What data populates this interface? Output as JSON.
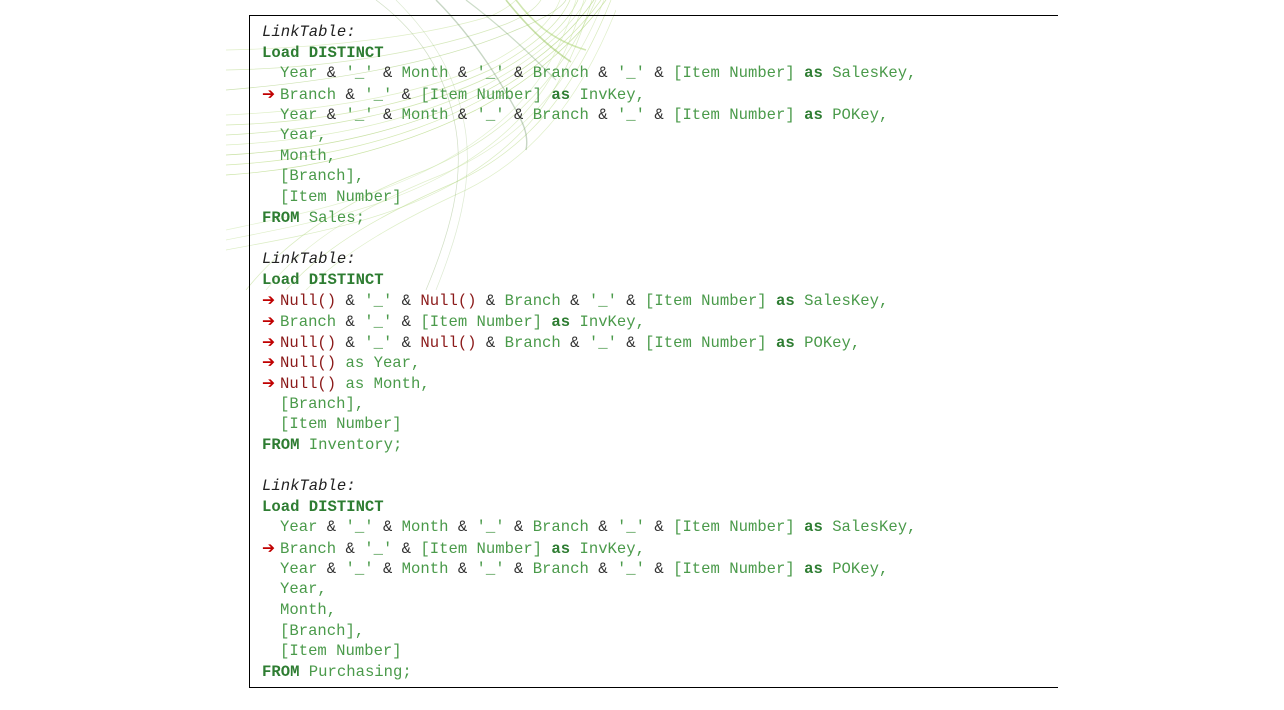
{
  "colors": {
    "keyword": "#2e7d32",
    "identifier": "#4a9a4a",
    "operator": "#333333",
    "null_function": "#8b1a1a",
    "arrow_marker": "#c00000",
    "label": "#222222",
    "swirl": "#8cc63f"
  },
  "icons": {
    "change_marker": "red-right-arrow-icon",
    "background": "green-swirl-decoration"
  },
  "blocks": [
    {
      "lines": [
        {
          "arrow": false,
          "indent": false,
          "tokens": [
            {
              "t": "LinkTable:",
              "c": "label"
            }
          ]
        },
        {
          "arrow": false,
          "indent": false,
          "tokens": [
            {
              "t": "Load DISTINCT",
              "c": "kw"
            }
          ]
        },
        {
          "arrow": false,
          "indent": true,
          "tokens": [
            {
              "t": "Year ",
              "c": "txt"
            },
            {
              "t": "& ",
              "c": "op"
            },
            {
              "t": "'_' ",
              "c": "txt"
            },
            {
              "t": "& ",
              "c": "op"
            },
            {
              "t": "Month ",
              "c": "txt"
            },
            {
              "t": "& ",
              "c": "op"
            },
            {
              "t": "'_' ",
              "c": "txt"
            },
            {
              "t": "& ",
              "c": "op"
            },
            {
              "t": "Branch ",
              "c": "txt"
            },
            {
              "t": "& ",
              "c": "op"
            },
            {
              "t": "'_' ",
              "c": "txt"
            },
            {
              "t": "& ",
              "c": "op"
            },
            {
              "t": "[Item Number] ",
              "c": "txt"
            },
            {
              "t": "as ",
              "c": "kw"
            },
            {
              "t": "SalesKey,",
              "c": "txt"
            }
          ]
        },
        {
          "arrow": true,
          "indent": false,
          "tokens": [
            {
              "t": "Branch ",
              "c": "txt"
            },
            {
              "t": "& ",
              "c": "op"
            },
            {
              "t": "'_' ",
              "c": "txt"
            },
            {
              "t": "& ",
              "c": "op"
            },
            {
              "t": "[Item Number] ",
              "c": "txt"
            },
            {
              "t": "as ",
              "c": "kw"
            },
            {
              "t": "InvKey,",
              "c": "txt"
            }
          ]
        },
        {
          "arrow": false,
          "indent": true,
          "tokens": [
            {
              "t": "Year ",
              "c": "txt"
            },
            {
              "t": "& ",
              "c": "op"
            },
            {
              "t": "'_' ",
              "c": "txt"
            },
            {
              "t": "& ",
              "c": "op"
            },
            {
              "t": "Month ",
              "c": "txt"
            },
            {
              "t": "& ",
              "c": "op"
            },
            {
              "t": "'_' ",
              "c": "txt"
            },
            {
              "t": "& ",
              "c": "op"
            },
            {
              "t": "Branch ",
              "c": "txt"
            },
            {
              "t": "& ",
              "c": "op"
            },
            {
              "t": "'_' ",
              "c": "txt"
            },
            {
              "t": "& ",
              "c": "op"
            },
            {
              "t": "[Item Number] ",
              "c": "txt"
            },
            {
              "t": "as ",
              "c": "kw"
            },
            {
              "t": "POKey,",
              "c": "txt"
            }
          ]
        },
        {
          "arrow": false,
          "indent": true,
          "tokens": [
            {
              "t": "Year,",
              "c": "txt"
            }
          ]
        },
        {
          "arrow": false,
          "indent": true,
          "tokens": [
            {
              "t": "Month,",
              "c": "txt"
            }
          ]
        },
        {
          "arrow": false,
          "indent": true,
          "tokens": [
            {
              "t": "[Branch],",
              "c": "txt"
            }
          ]
        },
        {
          "arrow": false,
          "indent": true,
          "tokens": [
            {
              "t": "[Item Number]",
              "c": "txt"
            }
          ]
        },
        {
          "arrow": false,
          "indent": false,
          "tokens": [
            {
              "t": "FROM ",
              "c": "kw"
            },
            {
              "t": "Sales;",
              "c": "txt"
            }
          ]
        }
      ]
    },
    {
      "lines": [
        {
          "arrow": false,
          "indent": false,
          "tokens": [
            {
              "t": "LinkTable:",
              "c": "label"
            }
          ]
        },
        {
          "arrow": false,
          "indent": false,
          "tokens": [
            {
              "t": "Load DISTINCT",
              "c": "kw"
            }
          ]
        },
        {
          "arrow": true,
          "indent": false,
          "tokens": [
            {
              "t": "Null() ",
              "c": "fn"
            },
            {
              "t": "& ",
              "c": "op"
            },
            {
              "t": "'_' ",
              "c": "txt"
            },
            {
              "t": "& ",
              "c": "op"
            },
            {
              "t": "Null() ",
              "c": "fn"
            },
            {
              "t": "& ",
              "c": "op"
            },
            {
              "t": "Branch ",
              "c": "txt"
            },
            {
              "t": "& ",
              "c": "op"
            },
            {
              "t": "'_' ",
              "c": "txt"
            },
            {
              "t": "& ",
              "c": "op"
            },
            {
              "t": "[Item Number] ",
              "c": "txt"
            },
            {
              "t": "as ",
              "c": "kw"
            },
            {
              "t": "SalesKey,",
              "c": "txt"
            }
          ]
        },
        {
          "arrow": true,
          "indent": false,
          "tokens": [
            {
              "t": "Branch ",
              "c": "txt"
            },
            {
              "t": "& ",
              "c": "op"
            },
            {
              "t": "'_' ",
              "c": "txt"
            },
            {
              "t": "& ",
              "c": "op"
            },
            {
              "t": "[Item Number] ",
              "c": "txt"
            },
            {
              "t": "as ",
              "c": "kw"
            },
            {
              "t": "InvKey,",
              "c": "txt"
            }
          ]
        },
        {
          "arrow": true,
          "indent": false,
          "tokens": [
            {
              "t": "Null() ",
              "c": "fn"
            },
            {
              "t": "& ",
              "c": "op"
            },
            {
              "t": "'_' ",
              "c": "txt"
            },
            {
              "t": "& ",
              "c": "op"
            },
            {
              "t": "Null() ",
              "c": "fn"
            },
            {
              "t": "& ",
              "c": "op"
            },
            {
              "t": "Branch ",
              "c": "txt"
            },
            {
              "t": "& ",
              "c": "op"
            },
            {
              "t": "'_' ",
              "c": "txt"
            },
            {
              "t": "& ",
              "c": "op"
            },
            {
              "t": "[Item Number] ",
              "c": "txt"
            },
            {
              "t": "as ",
              "c": "kw"
            },
            {
              "t": "POKey,",
              "c": "txt"
            }
          ]
        },
        {
          "arrow": true,
          "indent": false,
          "tokens": [
            {
              "t": "Null() ",
              "c": "fn"
            },
            {
              "t": "as ",
              "c": "txt"
            },
            {
              "t": "Year,",
              "c": "txt"
            }
          ]
        },
        {
          "arrow": true,
          "indent": false,
          "tokens": [
            {
              "t": "Null() ",
              "c": "fn"
            },
            {
              "t": "as ",
              "c": "txt"
            },
            {
              "t": "Month,",
              "c": "txt"
            }
          ]
        },
        {
          "arrow": false,
          "indent": true,
          "tokens": [
            {
              "t": "[Branch],",
              "c": "txt"
            }
          ]
        },
        {
          "arrow": false,
          "indent": true,
          "tokens": [
            {
              "t": "[Item Number]",
              "c": "txt"
            }
          ]
        },
        {
          "arrow": false,
          "indent": false,
          "tokens": [
            {
              "t": "FROM ",
              "c": "kw"
            },
            {
              "t": "Inventory;",
              "c": "txt"
            }
          ]
        }
      ]
    },
    {
      "lines": [
        {
          "arrow": false,
          "indent": false,
          "tokens": [
            {
              "t": "LinkTable:",
              "c": "label"
            }
          ]
        },
        {
          "arrow": false,
          "indent": false,
          "tokens": [
            {
              "t": "Load DISTINCT",
              "c": "kw"
            }
          ]
        },
        {
          "arrow": false,
          "indent": true,
          "tokens": [
            {
              "t": "Year ",
              "c": "txt"
            },
            {
              "t": "& ",
              "c": "op"
            },
            {
              "t": "'_' ",
              "c": "txt"
            },
            {
              "t": "& ",
              "c": "op"
            },
            {
              "t": "Month ",
              "c": "txt"
            },
            {
              "t": "& ",
              "c": "op"
            },
            {
              "t": "'_' ",
              "c": "txt"
            },
            {
              "t": "& ",
              "c": "op"
            },
            {
              "t": "Branch ",
              "c": "txt"
            },
            {
              "t": "& ",
              "c": "op"
            },
            {
              "t": "'_' ",
              "c": "txt"
            },
            {
              "t": "& ",
              "c": "op"
            },
            {
              "t": "[Item Number] ",
              "c": "txt"
            },
            {
              "t": "as ",
              "c": "kw"
            },
            {
              "t": "SalesKey,",
              "c": "txt"
            }
          ]
        },
        {
          "arrow": true,
          "indent": false,
          "tokens": [
            {
              "t": "Branch ",
              "c": "txt"
            },
            {
              "t": "& ",
              "c": "op"
            },
            {
              "t": "'_' ",
              "c": "txt"
            },
            {
              "t": "& ",
              "c": "op"
            },
            {
              "t": "[Item Number] ",
              "c": "txt"
            },
            {
              "t": "as ",
              "c": "kw"
            },
            {
              "t": "InvKey,",
              "c": "txt"
            }
          ]
        },
        {
          "arrow": false,
          "indent": true,
          "tokens": [
            {
              "t": "Year ",
              "c": "txt"
            },
            {
              "t": "& ",
              "c": "op"
            },
            {
              "t": "'_' ",
              "c": "txt"
            },
            {
              "t": "& ",
              "c": "op"
            },
            {
              "t": "Month ",
              "c": "txt"
            },
            {
              "t": "& ",
              "c": "op"
            },
            {
              "t": "'_' ",
              "c": "txt"
            },
            {
              "t": "& ",
              "c": "op"
            },
            {
              "t": "Branch ",
              "c": "txt"
            },
            {
              "t": "& ",
              "c": "op"
            },
            {
              "t": "'_' ",
              "c": "txt"
            },
            {
              "t": "& ",
              "c": "op"
            },
            {
              "t": "[Item Number] ",
              "c": "txt"
            },
            {
              "t": "as ",
              "c": "kw"
            },
            {
              "t": "POKey,",
              "c": "txt"
            }
          ]
        },
        {
          "arrow": false,
          "indent": true,
          "tokens": [
            {
              "t": "Year,",
              "c": "txt"
            }
          ]
        },
        {
          "arrow": false,
          "indent": true,
          "tokens": [
            {
              "t": "Month,",
              "c": "txt"
            }
          ]
        },
        {
          "arrow": false,
          "indent": true,
          "tokens": [
            {
              "t": "[Branch],",
              "c": "txt"
            }
          ]
        },
        {
          "arrow": false,
          "indent": true,
          "tokens": [
            {
              "t": "[Item Number]",
              "c": "txt"
            }
          ]
        },
        {
          "arrow": false,
          "indent": false,
          "tokens": [
            {
              "t": "FROM ",
              "c": "kw"
            },
            {
              "t": "Purchasing;",
              "c": "txt"
            }
          ]
        }
      ]
    }
  ]
}
